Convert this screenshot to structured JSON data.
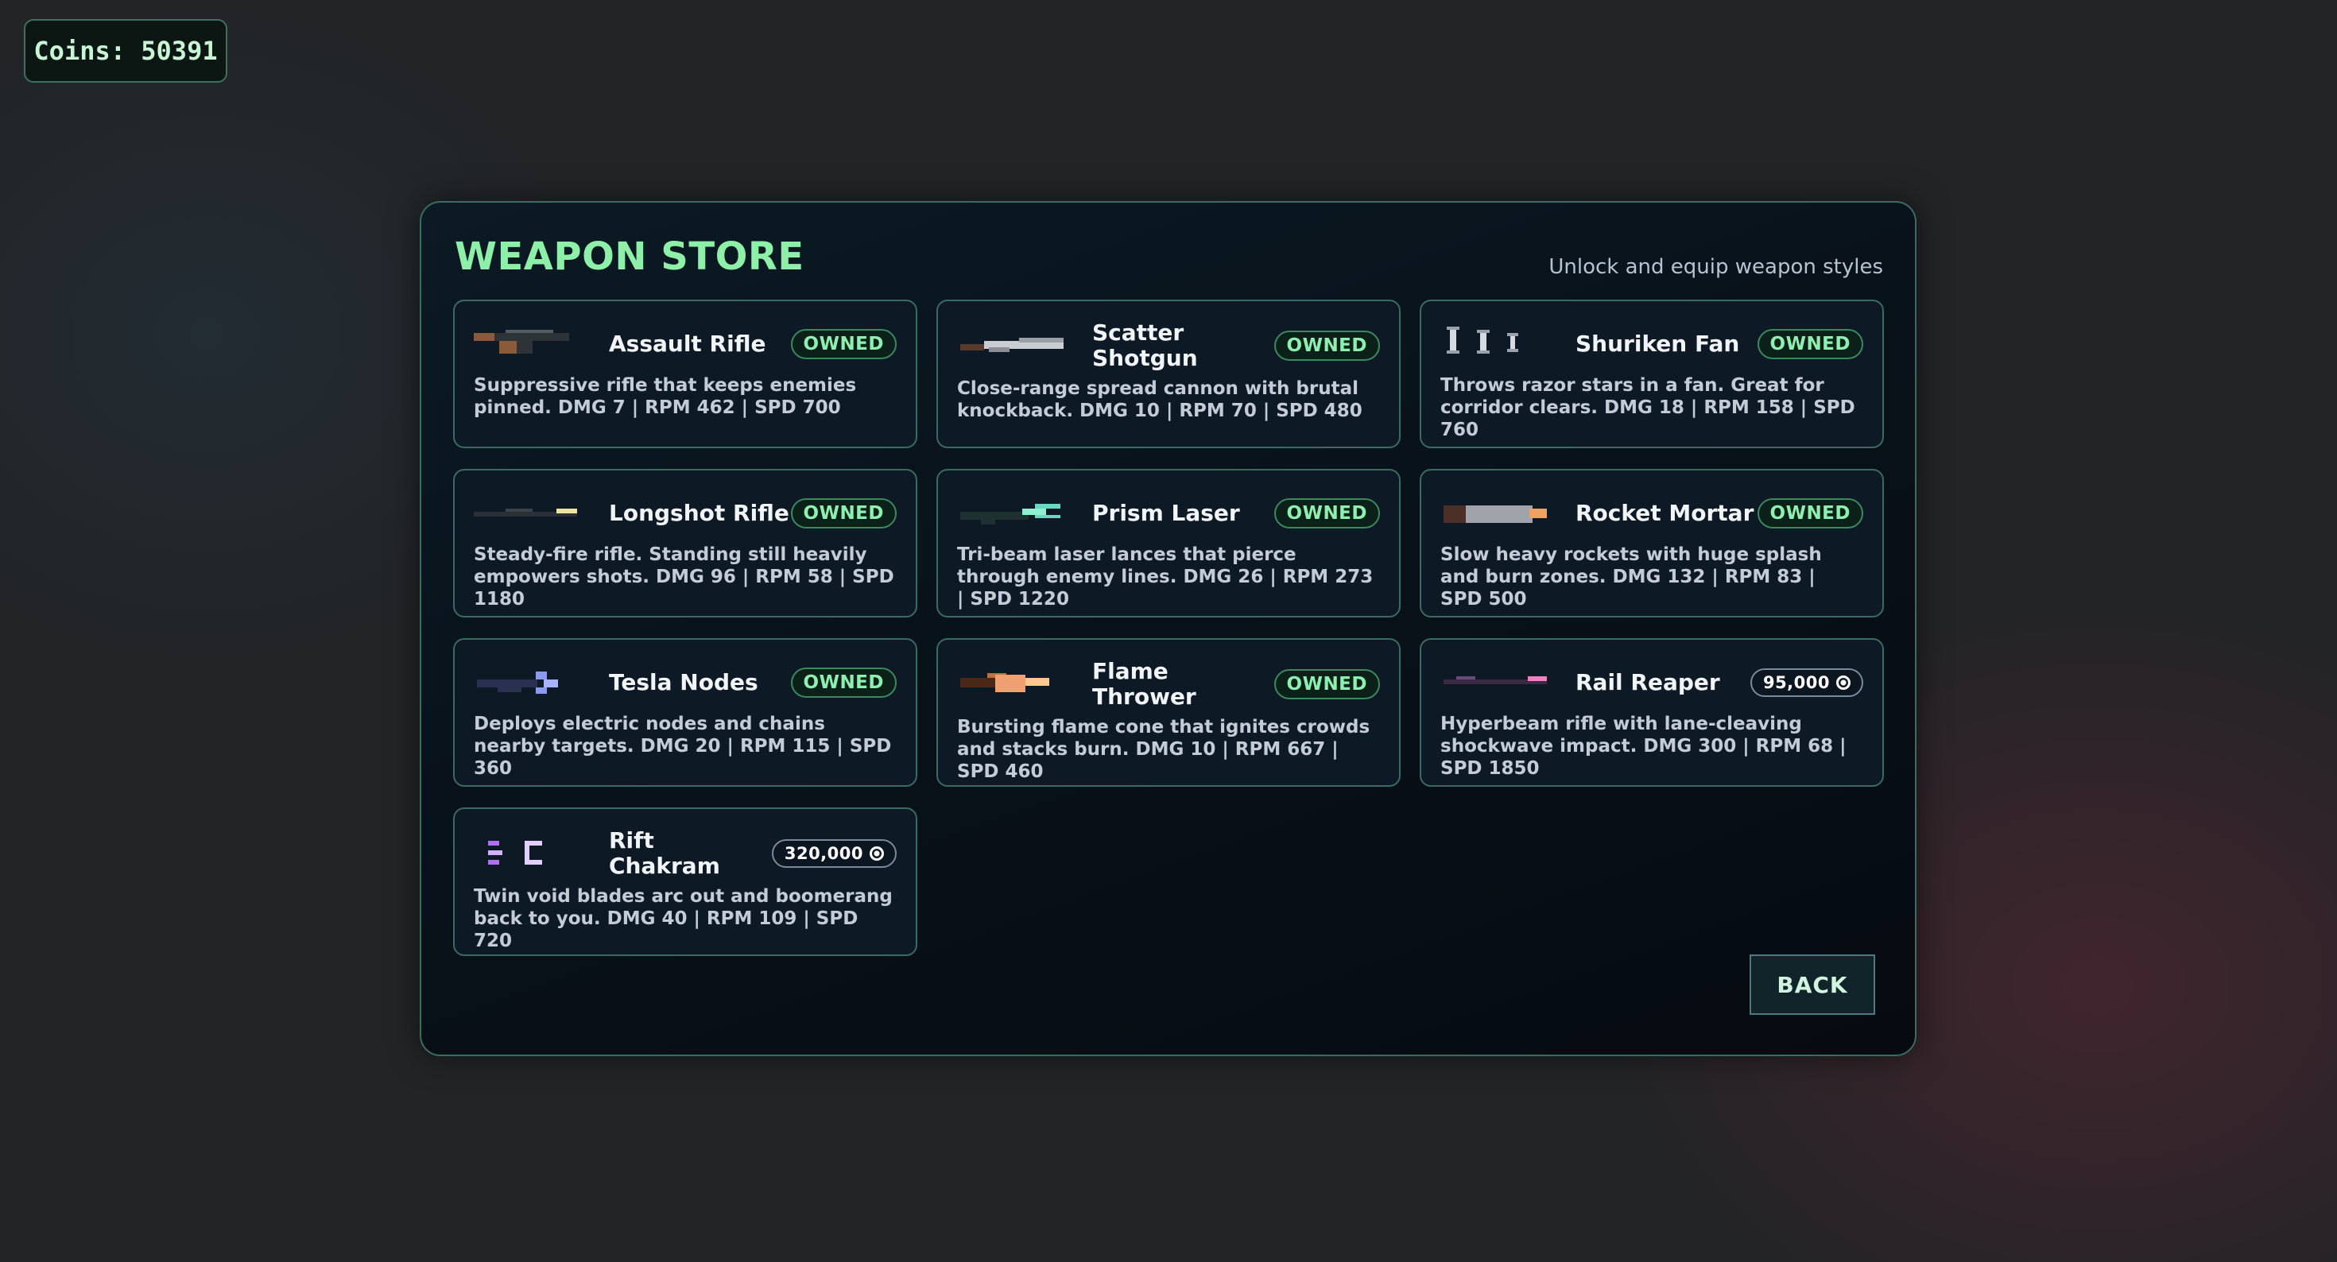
{
  "hud": {
    "coins_label": "Coins: 50391"
  },
  "store": {
    "title": "WEAPON STORE",
    "subtitle": "Unlock and equip weapon styles",
    "back_label": "BACK",
    "weapons": [
      {
        "name": "Assault Rifle",
        "icon": "assault-rifle-icon",
        "status": "OWNED",
        "desc": "Suppressive rifle that keeps enemies pinned. DMG 7 | RPM 462 | SPD 700"
      },
      {
        "name": "Scatter Shotgun",
        "icon": "scatter-shotgun-icon",
        "status": "OWNED",
        "desc": "Close-range spread cannon with brutal knockback. DMG 10 | RPM 70 | SPD 480"
      },
      {
        "name": "Shuriken Fan",
        "icon": "shuriken-fan-icon",
        "status": "OWNED",
        "desc": "Throws razor stars in a fan. Great for corridor clears. DMG 18 | RPM 158 | SPD 760"
      },
      {
        "name": "Longshot Rifle",
        "icon": "longshot-rifle-icon",
        "status": "OWNED",
        "desc": "Steady-fire rifle. Standing still heavily empowers shots. DMG 96 | RPM 58 | SPD 1180"
      },
      {
        "name": "Prism Laser",
        "icon": "prism-laser-icon",
        "status": "OWNED",
        "desc": "Tri-beam laser lances that pierce through enemy lines. DMG 26 | RPM 273 | SPD 1220"
      },
      {
        "name": "Rocket Mortar",
        "icon": "rocket-mortar-icon",
        "status": "OWNED",
        "desc": "Slow heavy rockets with huge splash and burn zones. DMG 132 | RPM 83 | SPD 500"
      },
      {
        "name": "Tesla Nodes",
        "icon": "tesla-nodes-icon",
        "status": "OWNED",
        "desc": "Deploys electric nodes and chains nearby targets. DMG 20 | RPM 115 | SPD 360"
      },
      {
        "name": "Flame Thrower",
        "icon": "flame-thrower-icon",
        "status": "OWNED",
        "desc": "Bursting flame cone that ignites crowds and stacks burn. DMG 10 | RPM 667 | SPD 460"
      },
      {
        "name": "Rail Reaper",
        "icon": "rail-reaper-icon",
        "status": "95,000",
        "desc": "Hyperbeam rifle with lane-cleaving shockwave impact. DMG 300 | RPM 68 | SPD 1850"
      },
      {
        "name": "Rift Chakram",
        "icon": "rift-chakram-icon",
        "status": "320,000",
        "desc": "Twin void blades arc out and boomerang back to you. DMG 40 | RPM 109 | SPD 720"
      }
    ]
  },
  "colors": {
    "title_green": "#8ef0a8",
    "owned_green": "#8ef0b0",
    "card_border": "#3a6a61",
    "panel_bg": "#081018"
  }
}
